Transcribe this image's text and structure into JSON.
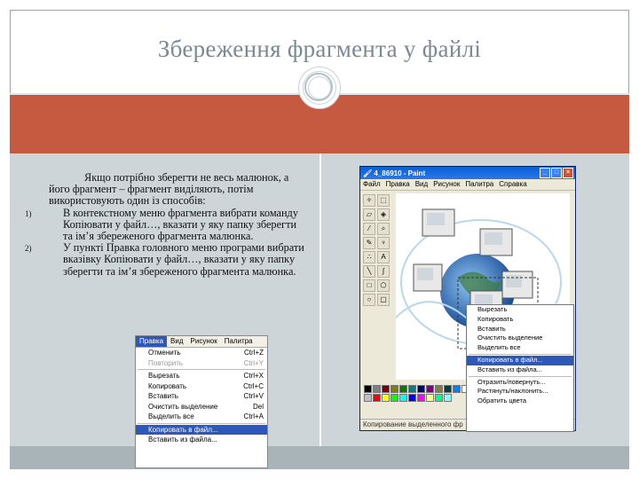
{
  "slide": {
    "title": "Збереження фрагмента у файлі",
    "intro": "Якщо потрібно зберегти не весь малюнок, а його фрагмент – фрагмент виділяють, потім використовують один із способів:",
    "list": [
      {
        "num": "1)",
        "text": "В контекстному меню фрагмента вибрати команду Копіювати у файл…, вказати у яку папку зберегти та ім’я збереженого фрагмента малюнка."
      },
      {
        "num": "2)",
        "text": "У пункті Правка головного меню програми вибрати вказівку Копіювати у файл…, вказати у яку папку зберегти та ім’я збереженого фрагмента малюнка."
      }
    ]
  },
  "menu_screenshot": {
    "menubar": [
      "Правка",
      "Вид",
      "Рисунок",
      "Палитра"
    ],
    "items": [
      {
        "label": "Отменить",
        "shortcut": "Ctrl+Z",
        "state": "normal"
      },
      {
        "label": "Повторить",
        "shortcut": "Ctrl+Y",
        "state": "dim"
      },
      {
        "sep": true
      },
      {
        "label": "Вырезать",
        "shortcut": "Ctrl+X",
        "state": "normal"
      },
      {
        "label": "Копировать",
        "shortcut": "Ctrl+C",
        "state": "normal"
      },
      {
        "label": "Вставить",
        "shortcut": "Ctrl+V",
        "state": "normal"
      },
      {
        "label": "Очистить выделение",
        "shortcut": "Del",
        "state": "normal"
      },
      {
        "label": "Выделить все",
        "shortcut": "Ctrl+A",
        "state": "normal"
      },
      {
        "sep": true
      },
      {
        "label": "Копировать в файл...",
        "shortcut": "",
        "state": "selected"
      },
      {
        "label": "Вставить из файла...",
        "shortcut": "",
        "state": "normal"
      }
    ]
  },
  "paint_window": {
    "title": "4_86910 - Paint",
    "menu": [
      "Файл",
      "Правка",
      "Вид",
      "Рисунок",
      "Палитра",
      "Справка"
    ],
    "status": "Копирование выделенного фр",
    "context_menu": [
      {
        "label": "Вырезать",
        "state": "normal"
      },
      {
        "label": "Копировать",
        "state": "normal"
      },
      {
        "label": "Вставить",
        "state": "normal"
      },
      {
        "label": "Очистить выделение",
        "state": "normal"
      },
      {
        "label": "Выделить все",
        "state": "normal"
      },
      {
        "sep": true
      },
      {
        "label": "Копировать в файл...",
        "state": "selected"
      },
      {
        "label": "Вставить из файла...",
        "state": "normal"
      },
      {
        "sep": true
      },
      {
        "label": "Отразить/повернуть...",
        "state": "normal"
      },
      {
        "label": "Растянуть/наклонить...",
        "state": "normal"
      },
      {
        "label": "Обратить цвета",
        "state": "normal"
      }
    ]
  },
  "colors": {
    "band": "#c55a40",
    "panel": "#cdd5d9",
    "title": "#7a8a95",
    "menu_highlight": "#2d57b8"
  }
}
